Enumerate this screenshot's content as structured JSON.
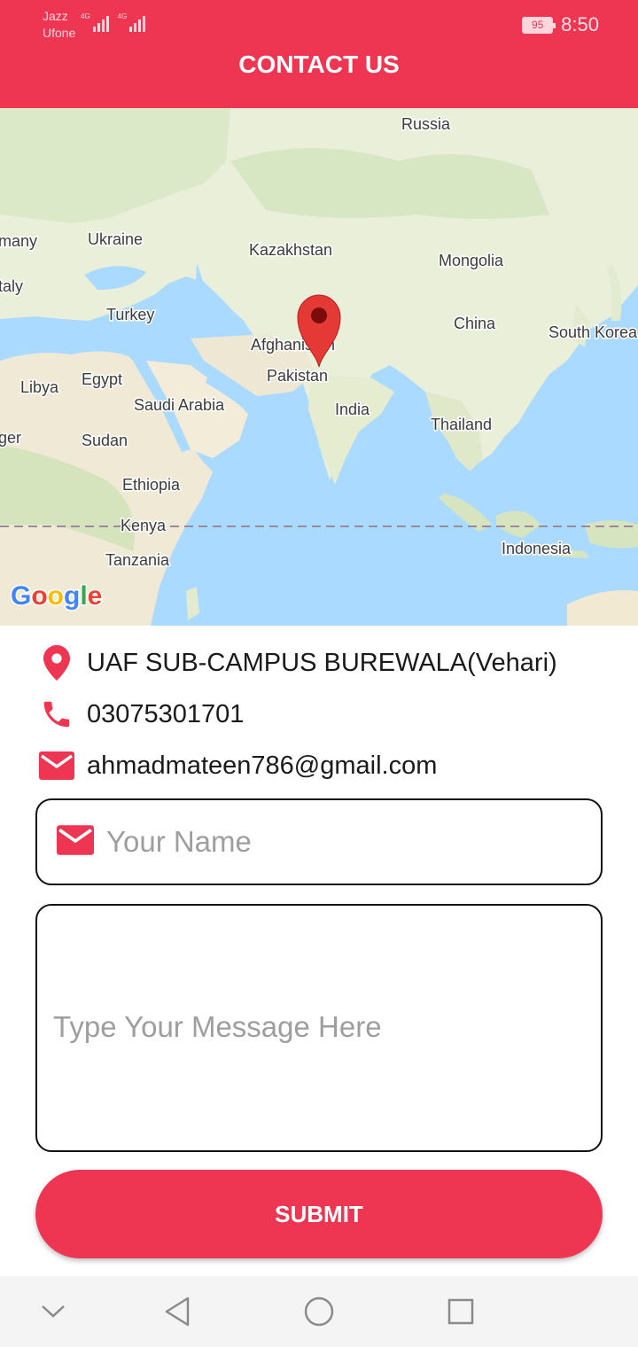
{
  "status": {
    "carrier1": "Jazz",
    "carrier2": "Ufone",
    "network1": "4G",
    "network2": "4G",
    "battery": "95",
    "time": "8:50"
  },
  "header": {
    "title": "CONTACT US"
  },
  "map": {
    "labels": {
      "russia": "Russia",
      "germany": "many",
      "ukraine": "Ukraine",
      "kazakhstan": "Kazakhstan",
      "mongolia": "Mongolia",
      "italy": "taly",
      "turkey": "Turkey",
      "afghanistan": "Afghanistan",
      "china": "China",
      "south_korea": "South Korea",
      "libya": "Libya",
      "egypt": "Egypt",
      "pakistan": "Pakistan",
      "saudi_arabia": "Saudi Arabia",
      "india": "India",
      "thailand": "Thailand",
      "niger": "ger",
      "sudan": "Sudan",
      "ethiopia": "Ethiopia",
      "kenya": "Kenya",
      "tanzania": "Tanzania",
      "indonesia": "Indonesia"
    },
    "logo": "Google"
  },
  "contact": {
    "address": "UAF SUB-CAMPUS BUREWALA(Vehari)",
    "phone": "03075301701",
    "email": "ahmadmateen786@gmail.com"
  },
  "form": {
    "name_placeholder": "Your Name",
    "message_placeholder": "Type Your Message Here",
    "submit_label": "SUBMIT"
  },
  "colors": {
    "accent": "#ee3552",
    "water": "#aadaff",
    "land": "#e8efd8"
  }
}
